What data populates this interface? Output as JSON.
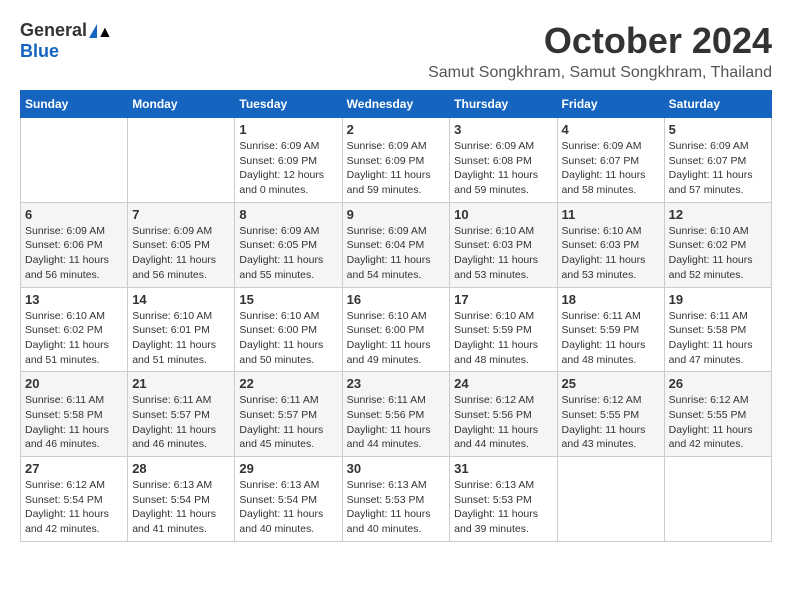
{
  "header": {
    "logo_general": "General",
    "logo_blue": "Blue",
    "month_title": "October 2024",
    "location": "Samut Songkhram, Samut Songkhram, Thailand"
  },
  "calendar": {
    "days_of_week": [
      "Sunday",
      "Monday",
      "Tuesday",
      "Wednesday",
      "Thursday",
      "Friday",
      "Saturday"
    ],
    "weeks": [
      [
        {
          "day": "",
          "info": ""
        },
        {
          "day": "",
          "info": ""
        },
        {
          "day": "1",
          "info": "Sunrise: 6:09 AM\nSunset: 6:09 PM\nDaylight: 12 hours\nand 0 minutes."
        },
        {
          "day": "2",
          "info": "Sunrise: 6:09 AM\nSunset: 6:09 PM\nDaylight: 11 hours\nand 59 minutes."
        },
        {
          "day": "3",
          "info": "Sunrise: 6:09 AM\nSunset: 6:08 PM\nDaylight: 11 hours\nand 59 minutes."
        },
        {
          "day": "4",
          "info": "Sunrise: 6:09 AM\nSunset: 6:07 PM\nDaylight: 11 hours\nand 58 minutes."
        },
        {
          "day": "5",
          "info": "Sunrise: 6:09 AM\nSunset: 6:07 PM\nDaylight: 11 hours\nand 57 minutes."
        }
      ],
      [
        {
          "day": "6",
          "info": "Sunrise: 6:09 AM\nSunset: 6:06 PM\nDaylight: 11 hours\nand 56 minutes."
        },
        {
          "day": "7",
          "info": "Sunrise: 6:09 AM\nSunset: 6:05 PM\nDaylight: 11 hours\nand 56 minutes."
        },
        {
          "day": "8",
          "info": "Sunrise: 6:09 AM\nSunset: 6:05 PM\nDaylight: 11 hours\nand 55 minutes."
        },
        {
          "day": "9",
          "info": "Sunrise: 6:09 AM\nSunset: 6:04 PM\nDaylight: 11 hours\nand 54 minutes."
        },
        {
          "day": "10",
          "info": "Sunrise: 6:10 AM\nSunset: 6:03 PM\nDaylight: 11 hours\nand 53 minutes."
        },
        {
          "day": "11",
          "info": "Sunrise: 6:10 AM\nSunset: 6:03 PM\nDaylight: 11 hours\nand 53 minutes."
        },
        {
          "day": "12",
          "info": "Sunrise: 6:10 AM\nSunset: 6:02 PM\nDaylight: 11 hours\nand 52 minutes."
        }
      ],
      [
        {
          "day": "13",
          "info": "Sunrise: 6:10 AM\nSunset: 6:02 PM\nDaylight: 11 hours\nand 51 minutes."
        },
        {
          "day": "14",
          "info": "Sunrise: 6:10 AM\nSunset: 6:01 PM\nDaylight: 11 hours\nand 51 minutes."
        },
        {
          "day": "15",
          "info": "Sunrise: 6:10 AM\nSunset: 6:00 PM\nDaylight: 11 hours\nand 50 minutes."
        },
        {
          "day": "16",
          "info": "Sunrise: 6:10 AM\nSunset: 6:00 PM\nDaylight: 11 hours\nand 49 minutes."
        },
        {
          "day": "17",
          "info": "Sunrise: 6:10 AM\nSunset: 5:59 PM\nDaylight: 11 hours\nand 48 minutes."
        },
        {
          "day": "18",
          "info": "Sunrise: 6:11 AM\nSunset: 5:59 PM\nDaylight: 11 hours\nand 48 minutes."
        },
        {
          "day": "19",
          "info": "Sunrise: 6:11 AM\nSunset: 5:58 PM\nDaylight: 11 hours\nand 47 minutes."
        }
      ],
      [
        {
          "day": "20",
          "info": "Sunrise: 6:11 AM\nSunset: 5:58 PM\nDaylight: 11 hours\nand 46 minutes."
        },
        {
          "day": "21",
          "info": "Sunrise: 6:11 AM\nSunset: 5:57 PM\nDaylight: 11 hours\nand 46 minutes."
        },
        {
          "day": "22",
          "info": "Sunrise: 6:11 AM\nSunset: 5:57 PM\nDaylight: 11 hours\nand 45 minutes."
        },
        {
          "day": "23",
          "info": "Sunrise: 6:11 AM\nSunset: 5:56 PM\nDaylight: 11 hours\nand 44 minutes."
        },
        {
          "day": "24",
          "info": "Sunrise: 6:12 AM\nSunset: 5:56 PM\nDaylight: 11 hours\nand 44 minutes."
        },
        {
          "day": "25",
          "info": "Sunrise: 6:12 AM\nSunset: 5:55 PM\nDaylight: 11 hours\nand 43 minutes."
        },
        {
          "day": "26",
          "info": "Sunrise: 6:12 AM\nSunset: 5:55 PM\nDaylight: 11 hours\nand 42 minutes."
        }
      ],
      [
        {
          "day": "27",
          "info": "Sunrise: 6:12 AM\nSunset: 5:54 PM\nDaylight: 11 hours\nand 42 minutes."
        },
        {
          "day": "28",
          "info": "Sunrise: 6:13 AM\nSunset: 5:54 PM\nDaylight: 11 hours\nand 41 minutes."
        },
        {
          "day": "29",
          "info": "Sunrise: 6:13 AM\nSunset: 5:54 PM\nDaylight: 11 hours\nand 40 minutes."
        },
        {
          "day": "30",
          "info": "Sunrise: 6:13 AM\nSunset: 5:53 PM\nDaylight: 11 hours\nand 40 minutes."
        },
        {
          "day": "31",
          "info": "Sunrise: 6:13 AM\nSunset: 5:53 PM\nDaylight: 11 hours\nand 39 minutes."
        },
        {
          "day": "",
          "info": ""
        },
        {
          "day": "",
          "info": ""
        }
      ]
    ]
  }
}
